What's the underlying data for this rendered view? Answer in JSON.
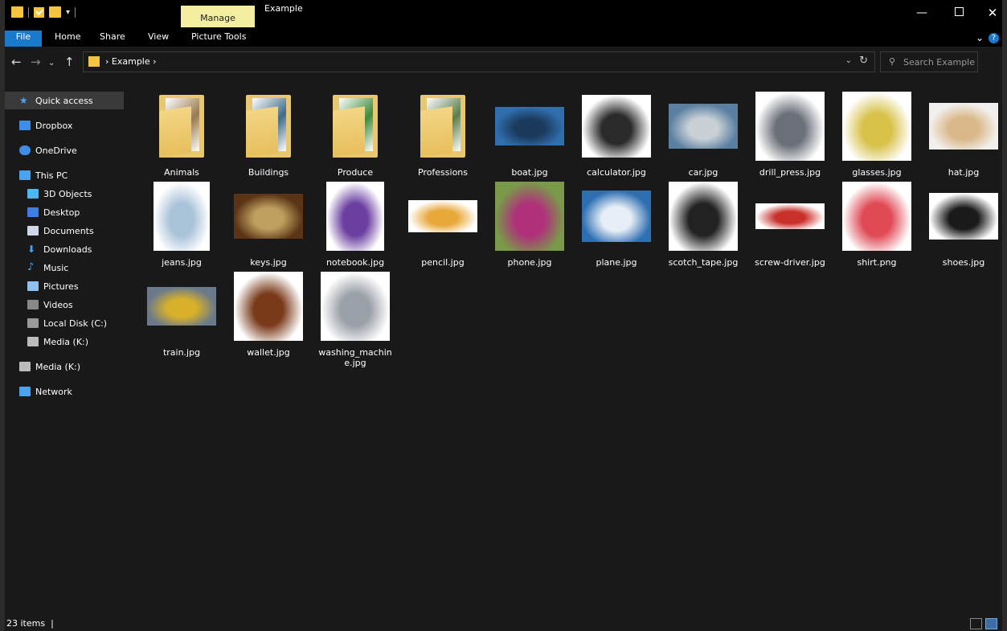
{
  "window": {
    "title": "Example",
    "contextual_tab": "Manage",
    "controls": {
      "minimize": "—",
      "maximize": "",
      "close": "✕"
    }
  },
  "ribbon": {
    "tabs": [
      "File",
      "Home",
      "Share",
      "View",
      "Picture Tools"
    ],
    "active_tab": "File",
    "accent_color": "#1979ca"
  },
  "address": {
    "path": [
      "Example"
    ],
    "search_placeholder": "Search Example"
  },
  "nav_pane": {
    "items": [
      {
        "label": "Quick access",
        "icon": "star-icon",
        "selected": true
      },
      {
        "label": "Dropbox",
        "icon": "dropbox-icon"
      },
      {
        "label": "OneDrive",
        "icon": "cloud-icon"
      },
      {
        "label": "This PC",
        "icon": "computer-icon"
      },
      {
        "label": "3D Objects",
        "icon": "cube-icon"
      },
      {
        "label": "Desktop",
        "icon": "desktop-icon"
      },
      {
        "label": "Documents",
        "icon": "document-icon"
      },
      {
        "label": "Downloads",
        "icon": "download-icon"
      },
      {
        "label": "Music",
        "icon": "music-icon"
      },
      {
        "label": "Pictures",
        "icon": "pictures-icon"
      },
      {
        "label": "Videos",
        "icon": "video-icon"
      },
      {
        "label": "Local Disk (C:)",
        "icon": "drive-icon"
      },
      {
        "label": "Media (K:)",
        "icon": "usb-drive-icon"
      },
      {
        "label": "Media (K:)",
        "icon": "usb-drive-icon"
      },
      {
        "label": "Network",
        "icon": "network-icon"
      }
    ]
  },
  "files": [
    {
      "name": "Animals",
      "kind": "folder",
      "tint": "#9a7a50"
    },
    {
      "name": "Buildings",
      "kind": "folder",
      "tint": "#3f6c8a"
    },
    {
      "name": "Produce",
      "kind": "folder",
      "tint": "#3f8a3a"
    },
    {
      "name": "Professions",
      "kind": "folder",
      "tint": "#5a7f4a"
    },
    {
      "name": "boat.jpg",
      "kind": "image",
      "colors": [
        "#2f6fae",
        "#1b3a5c"
      ]
    },
    {
      "name": "calculator.jpg",
      "kind": "image",
      "colors": [
        "#ffffff",
        "#2a2a2a"
      ]
    },
    {
      "name": "car.jpg",
      "kind": "image",
      "colors": [
        "#5a7fa0",
        "#c9d0d6"
      ]
    },
    {
      "name": "drill_press.jpg",
      "kind": "image",
      "colors": [
        "#ffffff",
        "#6a6f78"
      ]
    },
    {
      "name": "glasses.jpg",
      "kind": "image",
      "colors": [
        "#ffffff",
        "#d8c24a"
      ]
    },
    {
      "name": "hat.jpg",
      "kind": "image",
      "colors": [
        "#f2f0ee",
        "#d9b88a"
      ]
    },
    {
      "name": "jeans.jpg",
      "kind": "image",
      "colors": [
        "#ffffff",
        "#a9c3d9"
      ]
    },
    {
      "name": "keys.jpg",
      "kind": "image",
      "colors": [
        "#5a3414",
        "#c0a060"
      ]
    },
    {
      "name": "notebook.jpg",
      "kind": "image",
      "colors": [
        "#ffffff",
        "#6b3fa0"
      ]
    },
    {
      "name": "pencil.jpg",
      "kind": "image",
      "colors": [
        "#ffffff",
        "#e8a83a"
      ]
    },
    {
      "name": "phone.jpg",
      "kind": "image",
      "colors": [
        "#7a9a4a",
        "#b0307a"
      ]
    },
    {
      "name": "plane.jpg",
      "kind": "image",
      "colors": [
        "#2e6fb2",
        "#e8eef5"
      ]
    },
    {
      "name": "scotch_tape.jpg",
      "kind": "image",
      "colors": [
        "#ffffff",
        "#222222"
      ]
    },
    {
      "name": "screw-driver.jpg",
      "kind": "image",
      "colors": [
        "#ffffff",
        "#c8302a"
      ]
    },
    {
      "name": "shirt.png",
      "kind": "image",
      "colors": [
        "#ffffff",
        "#e04a55"
      ]
    },
    {
      "name": "shoes.jpg",
      "kind": "image",
      "colors": [
        "#ffffff",
        "#1a1a1a"
      ]
    },
    {
      "name": "train.jpg",
      "kind": "image",
      "colors": [
        "#6a7a8a",
        "#d8b02a"
      ]
    },
    {
      "name": "wallet.jpg",
      "kind": "image",
      "colors": [
        "#ffffff",
        "#7a3a1a"
      ]
    },
    {
      "name": "washing_machine.jpg",
      "kind": "image",
      "colors": [
        "#ffffff",
        "#9aa0a8"
      ]
    }
  ],
  "status": {
    "item_count": "23 items"
  }
}
